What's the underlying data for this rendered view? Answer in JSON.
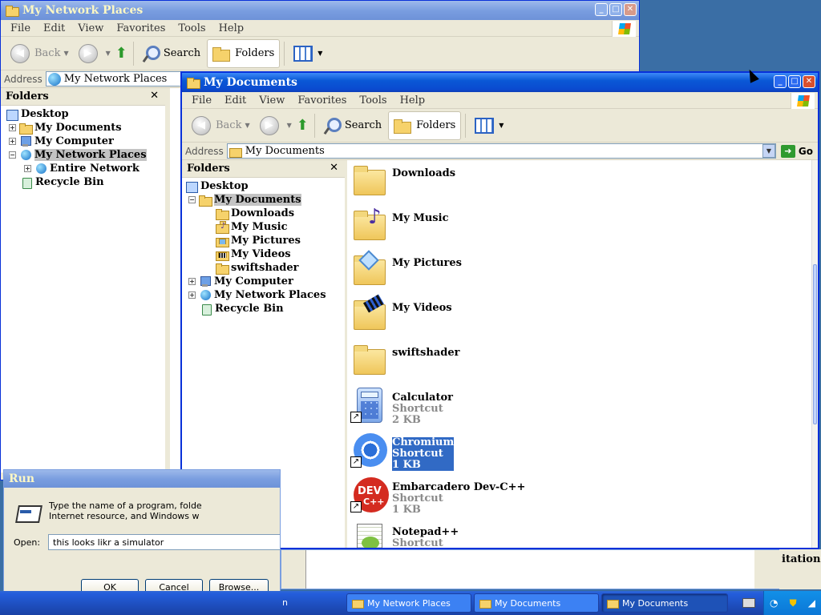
{
  "back_window": {
    "title": "My Network Places",
    "menu": [
      "File",
      "Edit",
      "View",
      "Favorites",
      "Tools",
      "Help"
    ],
    "toolbar": {
      "back": "Back",
      "search": "Search",
      "folders": "Folders"
    },
    "address_label": "Address",
    "address_value": "My Network Places",
    "folders_title": "Folders",
    "tree": [
      "Desktop",
      "My Documents",
      "My Computer",
      "My Network Places",
      "Entire Network",
      "Recycle Bin"
    ],
    "right_partial_text": "itation"
  },
  "front_window": {
    "title": "My Documents",
    "menu": [
      "File",
      "Edit",
      "View",
      "Favorites",
      "Tools",
      "Help"
    ],
    "toolbar": {
      "back": "Back",
      "search": "Search",
      "folders": "Folders"
    },
    "address_label": "Address",
    "address_value": "My Documents",
    "go": "Go",
    "folders_title": "Folders",
    "tree": [
      "Desktop",
      "My Documents",
      "Downloads",
      "My Music",
      "My Pictures",
      "My Videos",
      "swiftshader",
      "My Computer",
      "My Network Places",
      "Recycle Bin"
    ],
    "items": [
      {
        "name": "Downloads"
      },
      {
        "name": "My Music"
      },
      {
        "name": "My Pictures"
      },
      {
        "name": "My Videos"
      },
      {
        "name": "swiftshader"
      },
      {
        "name": "Calculator",
        "type": "Shortcut",
        "size": "2 KB"
      },
      {
        "name": "Chromium",
        "type": "Shortcut",
        "size": "1 KB"
      },
      {
        "name": "Embarcadero Dev-C++",
        "type": "Shortcut",
        "size": "1 KB"
      },
      {
        "name": "Notepad++",
        "type": "Shortcut"
      }
    ]
  },
  "run_dialog": {
    "title": "Run",
    "line1": "Type the name of a program, folde",
    "line2": "Internet resource, and Windows w",
    "open_label": "Open:",
    "open_value": "this looks likr a simulator",
    "ok": "OK",
    "cancel": "Cancel",
    "browse": "Browse..."
  },
  "taskbar": {
    "partial": "n",
    "items": [
      "My Network Places",
      "My Documents",
      "My Documents"
    ]
  },
  "colors": {
    "title_active": "#0a58d6",
    "selection": "#316ac5",
    "taskbar": "#245edc"
  }
}
